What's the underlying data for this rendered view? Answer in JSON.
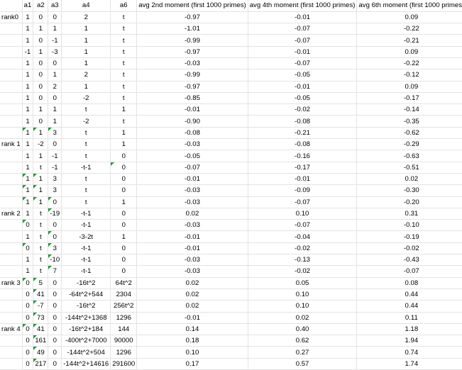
{
  "header": [
    "",
    "a1",
    "a2",
    "a3",
    "a4",
    "a6",
    "avg 2nd moment (first 1000 primes)",
    "avg 4th moment (first 1000 primes)",
    "avg 6th moment (first 1000 primes)"
  ],
  "rows": [
    {
      "rank": "rank0",
      "a1": "1",
      "a2": "0",
      "a3": "0",
      "a4": "2",
      "a6": "t",
      "m2": "-0.97",
      "m4": "-0.01",
      "m6": "0.09",
      "flags": []
    },
    {
      "rank": "",
      "a1": "1",
      "a2": "1",
      "a3": "1",
      "a4": "1",
      "a6": "t",
      "m2": "-1.01",
      "m4": "-0.07",
      "m6": "-0.22",
      "flags": []
    },
    {
      "rank": "",
      "a1": "1",
      "a2": "0",
      "a3": "-1",
      "a4": "1",
      "a6": "t",
      "m2": "-0.99",
      "m4": "-0.07",
      "m6": "-0.21",
      "flags": []
    },
    {
      "rank": "",
      "a1": "-1",
      "a2": "1",
      "a3": "-3",
      "a4": "1",
      "a6": "t",
      "m2": "-0.97",
      "m4": "-0.01",
      "m6": "0.09",
      "flags": []
    },
    {
      "rank": "",
      "a1": "1",
      "a2": "0",
      "a3": "0",
      "a4": "1",
      "a6": "t",
      "m2": "-0.03",
      "m4": "-0.07",
      "m6": "-0.22",
      "flags": []
    },
    {
      "rank": "",
      "a1": "1",
      "a2": "0",
      "a3": "1",
      "a4": "2",
      "a6": "t",
      "m2": "-0.99",
      "m4": "-0.05",
      "m6": "-0.12",
      "flags": []
    },
    {
      "rank": "",
      "a1": "1",
      "a2": "0",
      "a3": "2",
      "a4": "1",
      "a6": "t",
      "m2": "-0.97",
      "m4": "-0.01",
      "m6": "0.09",
      "flags": []
    },
    {
      "rank": "",
      "a1": "1",
      "a2": "0",
      "a3": "0",
      "a4": "-2",
      "a6": "t",
      "m2": "-0.85",
      "m4": "-0.05",
      "m6": "-0.17",
      "flags": []
    },
    {
      "rank": "",
      "a1": "1",
      "a2": "1",
      "a3": "1",
      "a4": "t",
      "a6": "1",
      "m2": "-0.01",
      "m4": "-0.02",
      "m6": "-0.14",
      "flags": []
    },
    {
      "rank": "",
      "a1": "1",
      "a2": "0",
      "a3": "1",
      "a4": "-2",
      "a6": "t",
      "m2": "-0.90",
      "m4": "-0.08",
      "m6": "-0.35",
      "flags": []
    },
    {
      "rank": "",
      "a1": "1",
      "a2": "1",
      "a3": "3",
      "a4": "t",
      "a6": "1",
      "m2": "-0.08",
      "m4": "-0.21",
      "m6": "-0.62",
      "flags": [
        "a1",
        "a2",
        "a3"
      ]
    },
    {
      "rank": "rank 1",
      "a1": "1",
      "a2": "-2",
      "a3": "0",
      "a4": "t",
      "a6": "1",
      "m2": "-0.03",
      "m4": "-0.08",
      "m6": "-0.29",
      "flags": []
    },
    {
      "rank": "",
      "a1": "1",
      "a2": "1",
      "a3": "-1",
      "a4": "t",
      "a6": "0",
      "m2": "-0.05",
      "m4": "-0.16",
      "m6": "-0.63",
      "flags": []
    },
    {
      "rank": "",
      "a1": "1",
      "a2": "t",
      "a3": "-1",
      "a4": "-t-1",
      "a6": "0",
      "m2": "-0.07",
      "m4": "-0.17",
      "m6": "-0.51",
      "flags": [
        "a6"
      ]
    },
    {
      "rank": "",
      "a1": "1",
      "a2": "1",
      "a3": "3",
      "a4": "t",
      "a6": "0",
      "m2": "-0.01",
      "m4": "-0.01",
      "m6": "0.02",
      "flags": [
        "a1",
        "a2"
      ]
    },
    {
      "rank": "",
      "a1": "1",
      "a2": "1",
      "a3": "3",
      "a4": "t",
      "a6": "0",
      "m2": "-0.03",
      "m4": "-0.09",
      "m6": "-0.30",
      "flags": [
        "a1",
        "a2"
      ]
    },
    {
      "rank": "",
      "a1": "1",
      "a2": "1",
      "a3": "0",
      "a4": "t",
      "a6": "1",
      "m2": "-0.03",
      "m4": "-0.07",
      "m6": "-0.20",
      "flags": [
        "a1",
        "a2",
        "a3"
      ]
    },
    {
      "rank": "rank 2",
      "a1": "1",
      "a2": "t",
      "a3": "-19",
      "a4": "-t-1",
      "a6": "0",
      "m2": "0.02",
      "m4": "0.10",
      "m6": "0.31",
      "flags": [
        "a3"
      ]
    },
    {
      "rank": "",
      "a1": "0",
      "a2": "t",
      "a3": "0",
      "a4": "-t-1",
      "a6": "0",
      "m2": "-0.03",
      "m4": "-0.07",
      "m6": "-0.10",
      "flags": [
        "a1"
      ]
    },
    {
      "rank": "",
      "a1": "1",
      "a2": "t",
      "a3": "0",
      "a4": "-3-2t",
      "a6": "1",
      "m2": "-0.01",
      "m4": "-0.04",
      "m6": "-0.19",
      "flags": [
        "a3"
      ]
    },
    {
      "rank": "",
      "a1": "0",
      "a2": "t",
      "a3": "3",
      "a4": "-t-1",
      "a6": "0",
      "m2": "-0.01",
      "m4": "-0.02",
      "m6": "-0.02",
      "flags": [
        "a1",
        "a3"
      ]
    },
    {
      "rank": "",
      "a1": "1",
      "a2": "t",
      "a3": "-10",
      "a4": "-t-1",
      "a6": "0",
      "m2": "-0.03",
      "m4": "-0.13",
      "m6": "-0.43",
      "flags": [
        "a3"
      ]
    },
    {
      "rank": "",
      "a1": "1",
      "a2": "t",
      "a3": "7",
      "a4": "-t-1",
      "a6": "0",
      "m2": "-0.03",
      "m4": "-0.02",
      "m6": "-0.07",
      "flags": [
        "a3"
      ]
    },
    {
      "rank": "rank 3",
      "a1": "0",
      "a2": "5",
      "a3": "0",
      "a4": "-16t^2",
      "a6": "64t^2",
      "m2": "0.02",
      "m4": "0.05",
      "m6": "0.08",
      "flags": [
        "a1",
        "a2"
      ]
    },
    {
      "rank": "",
      "a1": "0",
      "a2": "41",
      "a3": "0",
      "a4": "-64t^2+544",
      "a6": "2304",
      "m2": "0.02",
      "m4": "0.10",
      "m6": "0.44",
      "flags": [
        "a2"
      ]
    },
    {
      "rank": "",
      "a1": "0",
      "a2": "-7",
      "a3": "0",
      "a4": "-16t^2",
      "a6": "256t^2",
      "m2": "0.02",
      "m4": "0.10",
      "m6": "0.44",
      "flags": [
        "a2"
      ]
    },
    {
      "rank": "",
      "a1": "0",
      "a2": "73",
      "a3": "0",
      "a4": "-144t^2+1368",
      "a6": "1296",
      "m2": "-0.01",
      "m4": "0.02",
      "m6": "0.11",
      "flags": [
        "a2"
      ]
    },
    {
      "rank": "rank 4",
      "a1": "0",
      "a2": "41",
      "a3": "0",
      "a4": "-16t^2+184",
      "a6": "144",
      "m2": "0.14",
      "m4": "0.40",
      "m6": "1.18",
      "flags": [
        "a1",
        "a2"
      ]
    },
    {
      "rank": "",
      "a1": "0",
      "a2": "161",
      "a3": "0",
      "a4": "-400t^2+7000",
      "a6": "90000",
      "m2": "0.18",
      "m4": "0.62",
      "m6": "1.94",
      "flags": [
        "a2"
      ]
    },
    {
      "rank": "",
      "a1": "0",
      "a2": "49",
      "a3": "0",
      "a4": "-144t^2+504",
      "a6": "1296",
      "m2": "0.10",
      "m4": "0.27",
      "m6": "0.74",
      "flags": [
        "a2"
      ]
    },
    {
      "rank": "",
      "a1": "0",
      "a2": "217",
      "a3": "0",
      "a4": "-144t^2+14616",
      "a6": "291600",
      "m2": "0.17",
      "m4": "0.57",
      "m6": "1.74",
      "flags": [
        "a2"
      ]
    }
  ],
  "colors": {
    "gridline": "#e3e3e3",
    "indicator": "#1e9b3c"
  }
}
